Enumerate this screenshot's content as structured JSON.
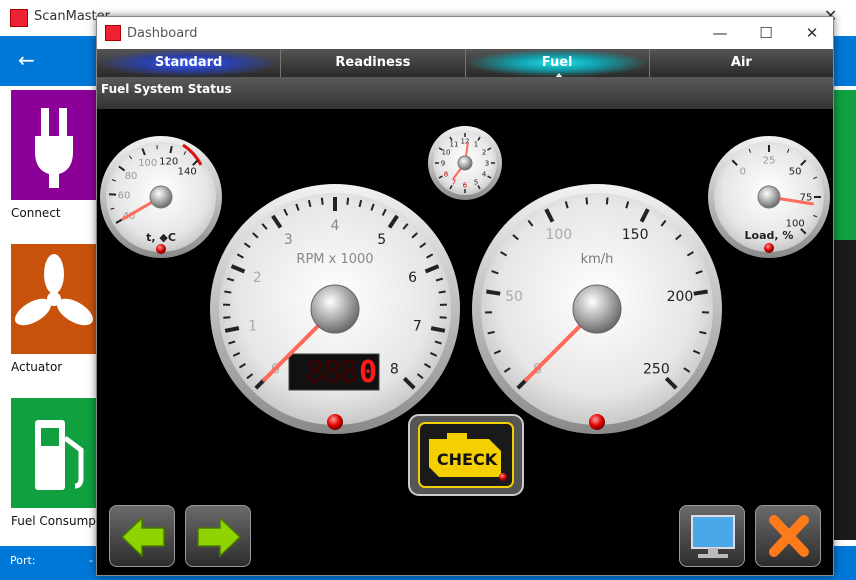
{
  "background_app": {
    "title": "ScanMaster",
    "tiles": [
      {
        "label": "Connect",
        "color": "#8c0099"
      },
      {
        "label": "Actuator",
        "color": "#c8520b"
      },
      {
        "label": "Fuel Consumpt",
        "color": "#10a040"
      }
    ],
    "status": {
      "port_label": "Port:",
      "port_value": "-"
    }
  },
  "window": {
    "title": "Dashboard",
    "tabs": [
      {
        "label": "Standard"
      },
      {
        "label": "Readiness"
      },
      {
        "label": "Fuel"
      },
      {
        "label": "Air"
      }
    ],
    "active_tab": "Fuel",
    "status_title": "Fuel System Status"
  },
  "gauges": {
    "temp": {
      "label": "t, ◆C",
      "ticks": [
        "40",
        "60",
        "80",
        "100",
        "120",
        "140"
      ],
      "value": 40
    },
    "rpm": {
      "label": "RPM x 1000",
      "ticks": [
        "0",
        "1",
        "2",
        "3",
        "4",
        "5",
        "6",
        "7",
        "8"
      ],
      "value": 0,
      "digital": "0"
    },
    "speed": {
      "label": "km/h",
      "ticks": [
        "0",
        "50",
        "100",
        "150",
        "200",
        "250"
      ],
      "value": 0
    },
    "load": {
      "label": "Load, %",
      "ticks": [
        "0",
        "25",
        "50",
        "75",
        "100"
      ],
      "value": 80
    },
    "clock": {
      "ticks": [
        "12",
        "1",
        "2",
        "3",
        "4",
        "5",
        "6",
        "7",
        "8",
        "9",
        "10",
        "11"
      ]
    }
  },
  "check_engine": {
    "label": "CHECK"
  },
  "colors": {
    "accent_blue": "#0078d7",
    "needle": "#ff6a5a",
    "check_yellow": "#f5d000"
  }
}
